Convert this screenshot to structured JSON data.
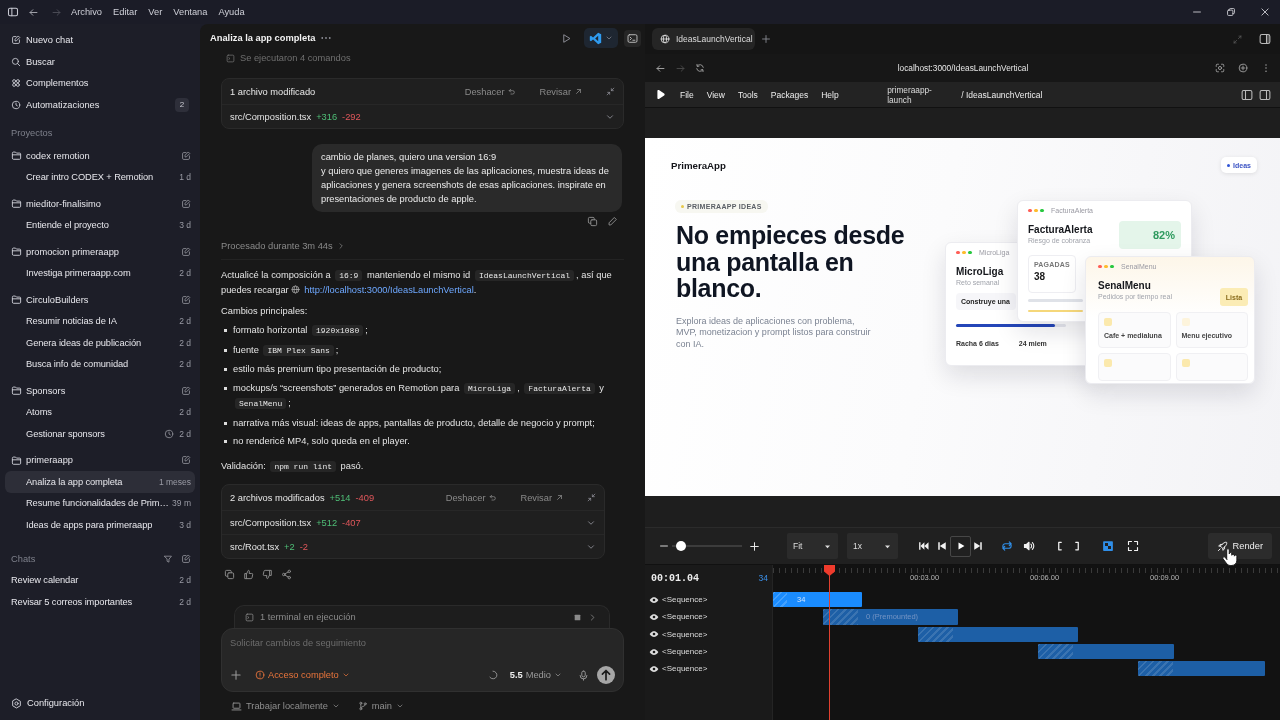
{
  "titlebar": {
    "history": [
      {
        "kind": "back",
        "disabled": false
      },
      {
        "kind": "forward",
        "disabled": true
      }
    ],
    "menu": [
      "Archivo",
      "Editar",
      "Ver",
      "Ventana",
      "Ayuda"
    ]
  },
  "sidebar": {
    "nav": [
      {
        "kind": "new",
        "label": "Nuevo chat"
      },
      {
        "kind": "search",
        "label": "Buscar"
      },
      {
        "kind": "plugins",
        "label": "Complementos"
      },
      {
        "kind": "automations",
        "label": "Automatizaciones",
        "badge": "2"
      }
    ],
    "projects_label": "Proyectos",
    "projects": [
      {
        "name": "codex remotion",
        "chats": [
          {
            "title": "Crear intro CODEX + Remotion",
            "age": "1 d",
            "selected": false,
            "scheduled": false
          }
        ]
      },
      {
        "name": "mieditor-finalisimo",
        "chats": [
          {
            "title": "Entiende el proyecto",
            "age": "3 d",
            "selected": false,
            "scheduled": false
          }
        ]
      },
      {
        "name": "promocion primeraapp",
        "chats": [
          {
            "title": "Investiga primeraapp.com",
            "age": "2 d",
            "selected": false,
            "scheduled": false
          }
        ]
      },
      {
        "name": "CirculoBuilders",
        "chats": [
          {
            "title": "Resumir noticias de IA",
            "age": "2 d",
            "selected": false,
            "scheduled": false
          },
          {
            "title": "Genera ideas de publicación",
            "age": "2 d",
            "selected": false,
            "scheduled": false
          },
          {
            "title": "Busca info de comunidad",
            "age": "2 d",
            "selected": false,
            "scheduled": false
          }
        ]
      },
      {
        "name": "Sponsors",
        "chats": [
          {
            "title": "Atoms",
            "age": "2 d",
            "selected": false,
            "scheduled": false
          },
          {
            "title": "Gestionar sponsors",
            "age": "2 d",
            "selected": false,
            "scheduled": true
          }
        ]
      },
      {
        "name": "primeraapp",
        "chats": [
          {
            "title": "Analiza la app completa",
            "age": "1 meses",
            "selected": true,
            "scheduled": false
          },
          {
            "title": "Resume funcionalidades de Prim…",
            "age": "39 m",
            "selected": false,
            "scheduled": false
          },
          {
            "title": "Ideas de apps para primeraapp",
            "age": "3 d",
            "selected": false,
            "scheduled": false
          }
        ]
      }
    ],
    "chats_label": "Chats",
    "chats": [
      {
        "title": "Review calendar",
        "age": "2 d",
        "selected": false,
        "scheduled": false
      },
      {
        "title": "Revisar 5 correos importantes",
        "age": "2 d",
        "selected": false,
        "scheduled": false
      }
    ],
    "settings_label": "Configuración"
  },
  "thread": {
    "title": "Analiza la app completa",
    "blocks": [
      {
        "kind": "note",
        "text": "Se ejecutaron 4 comandos"
      },
      {
        "kind": "changes",
        "title": "1 archivo modificado",
        "undo": "Deshacer",
        "review": "Revisar",
        "files": [
          {
            "path": "src/Composition.tsx",
            "added": "+316",
            "removed": "-292"
          }
        ]
      },
      {
        "kind": "user",
        "text": "cambio de planes, quiero una version 16:9\ny quiero que generes imagenes de las aplicaciones, muestra ideas de aplicaciones y genera screenshots de esas aplicaciones. inspirate en presentaciones de producto de apple."
      },
      {
        "kind": "processed",
        "text": "Procesado durante 3m 44s"
      },
      {
        "kind": "paragraph",
        "parts": [
          {
            "kind": "text",
            "text": "Actualicé la composición a "
          },
          {
            "kind": "code",
            "text": "16:9"
          },
          {
            "kind": "text",
            "text": " manteniendo el mismo id "
          },
          {
            "kind": "code",
            "text": "IdeasLaunchVertical"
          },
          {
            "kind": "text",
            "text": ", así que puedes recargar "
          },
          {
            "kind": "link",
            "text": "http://localhost:3000/IdeasLaunchVertical"
          },
          {
            "kind": "text",
            "text": "."
          }
        ]
      },
      {
        "kind": "paragraph",
        "parts": [
          {
            "kind": "text",
            "text": "Cambios principales:"
          }
        ]
      },
      {
        "kind": "bullets",
        "items": [
          {
            "parts": [
              {
                "kind": "text",
                "text": "formato horizontal "
              },
              {
                "kind": "code",
                "text": "1920x1080"
              },
              {
                "kind": "text",
                "text": ";"
              }
            ]
          },
          {
            "parts": [
              {
                "kind": "text",
                "text": "fuente "
              },
              {
                "kind": "code",
                "text": "IBM Plex Sans"
              },
              {
                "kind": "text",
                "text": ";"
              }
            ]
          },
          {
            "parts": [
              {
                "kind": "text",
                "text": "estilo más premium tipo presentación de producto;"
              }
            ]
          },
          {
            "parts": [
              {
                "kind": "text",
                "text": "mockups/s “screenshots” generados en Remotion para "
              },
              {
                "kind": "code",
                "text": "MicroLiga"
              },
              {
                "kind": "text",
                "text": ", "
              },
              {
                "kind": "code",
                "text": "FacturaAlerta"
              },
              {
                "kind": "text",
                "text": " y "
              },
              {
                "kind": "code",
                "text": "SenalMenu"
              },
              {
                "kind": "text",
                "text": ";"
              }
            ]
          },
          {
            "parts": [
              {
                "kind": "text",
                "text": "narrativa más visual: ideas de apps, pantallas de producto, detalle de negocio y prompt;"
              }
            ]
          },
          {
            "parts": [
              {
                "kind": "text",
                "text": "no rendericé MP4, solo queda en el player."
              }
            ]
          }
        ]
      },
      {
        "kind": "paragraph",
        "parts": [
          {
            "kind": "text",
            "text": "Validación: "
          },
          {
            "kind": "code",
            "text": "npm run lint"
          },
          {
            "kind": "text",
            "text": " pasó."
          }
        ]
      },
      {
        "kind": "changes",
        "title": "2 archivos modificados",
        "added": "+514",
        "removed": "-409",
        "undo": "Deshacer",
        "review": "Revisar",
        "files": [
          {
            "path": "src/Composition.tsx",
            "added": "+512",
            "removed": "-407"
          },
          {
            "path": "src/Root.tsx",
            "added": "+2",
            "removed": "-2"
          }
        ]
      },
      {
        "kind": "feedback"
      }
    ],
    "terminal": "1 terminal en ejecución",
    "composer": {
      "placeholder": "Solicitar cambios de seguimiento",
      "access": "Acceso completo",
      "model": "5.5",
      "effort": "Medio"
    },
    "footer": {
      "workspace": "Trabajar localmente",
      "branch": "main"
    }
  },
  "browser": {
    "tab": "IdeasLaunchVertical",
    "history": [
      {
        "kind": "back",
        "disabled": false
      },
      {
        "kind": "forward",
        "disabled": true
      }
    ],
    "url": "localhost:3000/IdeasLaunchVertical"
  },
  "studio": {
    "menu": [
      "File",
      "View",
      "Tools",
      "Packages",
      "Help"
    ],
    "project": "primeraapp-launch",
    "composition": "/ IdeasLaunchVertical",
    "preview": {
      "brand": "PrimeraApp",
      "nav_chip": "Ideas",
      "eyebrow": "PRIMERAAPP IDEAS",
      "headline": "No empieces desde una pantalla en blanco.",
      "lead": "Explora ideas de aplicaciones con problema, MVP, monetizacion y prompt listos para construir con IA.",
      "mockups": [
        {
          "kind": "league",
          "window_label": "MicroLiga",
          "title": "MicroLiga",
          "subtitle": "Reto semanal",
          "task": "Construye una",
          "level": 0.9,
          "streak": "Racha 6 dias",
          "members": "24 miem"
        },
        {
          "kind": "invoices",
          "window_label": "FacturaAlerta",
          "title": "FacturaAlerta",
          "subtitle": "Riesgo de cobranza",
          "score": "82%",
          "stat_label": "PAGADAS",
          "stat_value": "38"
        },
        {
          "kind": "menu",
          "window_label": "SenalMenu",
          "title": "SenalMenu",
          "subtitle": "Pedidos por tiempo real",
          "badge": "Lista",
          "items": [
            "Cafe + medialuna",
            "Menu ejecutivo"
          ]
        }
      ]
    },
    "player": {
      "zoom": {
        "level": 0.13
      },
      "fit": "Fit",
      "speed": "1x",
      "controls": [
        {
          "kind": "first",
          "on": false
        },
        {
          "kind": "prev",
          "on": false
        },
        {
          "kind": "play",
          "on": false
        },
        {
          "kind": "next",
          "on": false
        },
        {
          "kind": "loop",
          "on": true
        },
        {
          "kind": "volume",
          "on": false
        },
        {
          "kind": "in_mark",
          "on": false
        },
        {
          "kind": "out_mark",
          "on": false
        },
        {
          "kind": "checkerboard",
          "on": true
        },
        {
          "kind": "fullscreen",
          "on": false
        }
      ],
      "render": "Render"
    },
    "timeline": {
      "time": "00:01.04",
      "frame": "34",
      "ticks": [
        "00:03.00",
        "00:06.00",
        "00:09.00"
      ],
      "tracks": [
        {
          "name": "<Sequence>",
          "visible": true,
          "selected": true,
          "clip_label": "34"
        },
        {
          "name": "<Sequence>",
          "visible": true,
          "selected": false,
          "clip_label": "0 (Premounted)"
        },
        {
          "name": "<Sequence>",
          "visible": true,
          "selected": false
        },
        {
          "name": "<Sequence>",
          "visible": true,
          "selected": false
        },
        {
          "name": "<Sequence>",
          "visible": true,
          "selected": false
        }
      ]
    }
  }
}
